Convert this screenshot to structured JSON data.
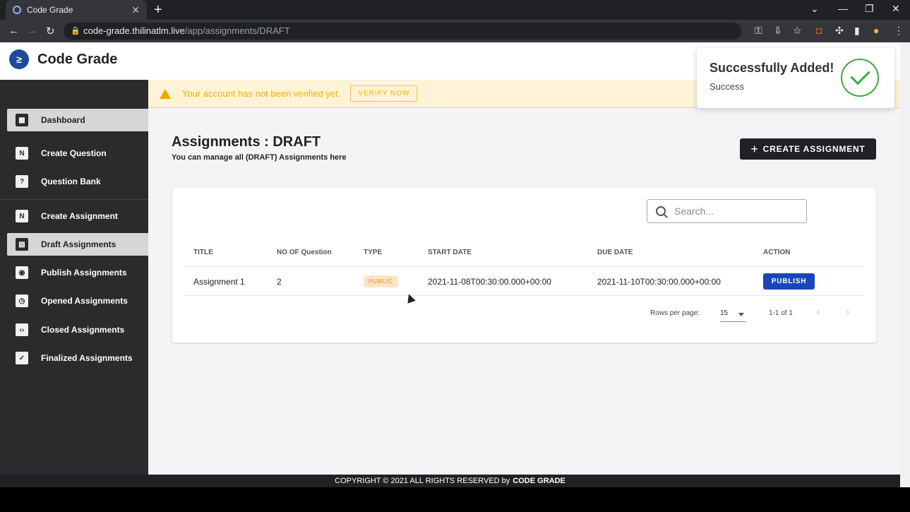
{
  "browser": {
    "tab_title": "Code Grade",
    "url_host": "code-grade.thilinatlm.live",
    "url_path": "/app/assignments/DRAFT"
  },
  "app": {
    "title": "Code Grade",
    "logo_glyph": "≥"
  },
  "sidebar": {
    "items": [
      {
        "label": "Dashboard",
        "icon": "dashboard-icon"
      },
      {
        "label": "Create Question",
        "icon": "new-icon"
      },
      {
        "label": "Question Bank",
        "icon": "question-icon"
      },
      {
        "label": "Create Assignment",
        "icon": "new-icon"
      },
      {
        "label": "Draft Assignments",
        "icon": "document-icon"
      },
      {
        "label": "Publish Assignments",
        "icon": "document-eye-icon"
      },
      {
        "label": "Opened Assignments",
        "icon": "document-clock-icon"
      },
      {
        "label": "Closed Assignments",
        "icon": "document-code-icon"
      },
      {
        "label": "Finalized Assignments",
        "icon": "document-check-icon"
      }
    ]
  },
  "warning": {
    "message": "Your account has not been verified yet.",
    "button": "VERIFY NOW"
  },
  "page": {
    "title": "Assignments : DRAFT",
    "subtitle": "You can manage all (DRAFT) Assignments here",
    "create_button": "CREATE ASSIGNMENT"
  },
  "search": {
    "placeholder": "Search..."
  },
  "table": {
    "headers": [
      "TITLE",
      "NO OF Question",
      "TYPE",
      "START DATE",
      "DUE DATE",
      "ACTION"
    ],
    "rows": [
      {
        "title": "Assignment 1",
        "questions": "2",
        "type": "PUBLIC",
        "start": "2021-11-08T00:30:00.000+00:00",
        "due": "2021-11-10T00:30:00.000+00:00",
        "action": "PUBLISH"
      }
    ]
  },
  "pagination": {
    "rows_label": "Rows per page:",
    "rows_value": "15",
    "range": "1-1 of 1"
  },
  "toast": {
    "title": "Successfully Added!",
    "subtitle": "Success"
  },
  "footer": {
    "text": "COPYRIGHT © 2021 ALL RIGHTS RESERVED by",
    "brand": "CODE GRADE"
  },
  "colors": {
    "sidebar": "#2b2b2e",
    "accent": "#1a47b8",
    "warning": "#f0b300",
    "success": "#3cab3c"
  }
}
